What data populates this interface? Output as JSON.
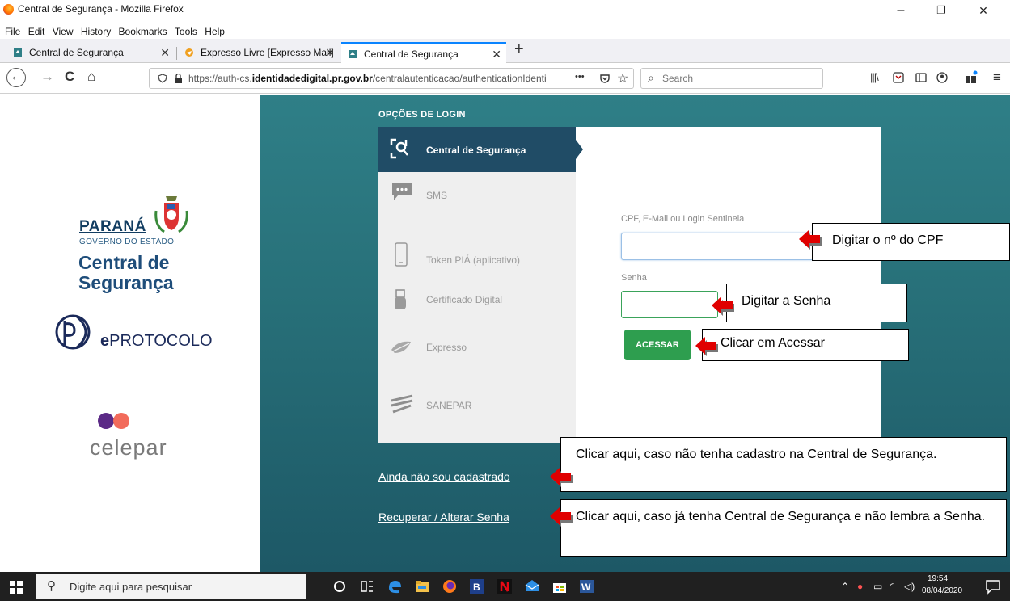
{
  "window": {
    "title": "Central de Segurança - Mozilla Firefox",
    "controls": {
      "minimize": "–",
      "maximize": "❐",
      "close": "✕"
    }
  },
  "menu": [
    "File",
    "Edit",
    "View",
    "History",
    "Bookmarks",
    "Tools",
    "Help"
  ],
  "tabs": [
    {
      "label": "Central de Segurança",
      "close": "✕"
    },
    {
      "label": "Expresso Livre [Expresso Mail]",
      "close": "✕"
    },
    {
      "label": "Central de Segurança",
      "close": "✕"
    }
  ],
  "new_tab": "+",
  "nav": {
    "back": "←",
    "forward": "→",
    "reload": "C",
    "home": "⌂",
    "url_prefix": "https://auth-cs.",
    "url_domain": "identidadedigital.pr.gov.br",
    "url_path": "/centralautenticacao/authenticationIdenti",
    "more": "•••",
    "search_placeholder": "Search"
  },
  "left": {
    "parana": "PARANÁ",
    "governo": "GOVERNO DO ESTADO",
    "central1": "Central de",
    "central2": "Segurança",
    "eprotocolo_e": "e",
    "eprotocolo_rest": "PROTOCOLO",
    "celepar": "celepar"
  },
  "login": {
    "heading": "OPÇÕES DE LOGIN",
    "options": [
      {
        "label": "Central de Segurança"
      },
      {
        "label": "SMS"
      },
      {
        "label": "Token PIÁ (aplicativo)"
      },
      {
        "label": "Certificado Digital"
      },
      {
        "label": "Expresso"
      },
      {
        "label": "SANEPAR"
      }
    ],
    "cpf_label": "CPF, E-Mail ou Login Sentinela",
    "cpf_value": "",
    "senha_label": "Senha",
    "senha_value": "",
    "button": "ACESSAR"
  },
  "links": {
    "cadastro": "Ainda não sou cadastrado",
    "recuperar": "Recuperar / Alterar Senha"
  },
  "callouts": {
    "cpf": "Digitar o nº do CPF",
    "senha": "Digitar a Senha",
    "acessar": "Clicar em Acessar",
    "cadastro": "Clicar aqui, caso não tenha cadastro na Central de Segurança.",
    "recuperar": "Clicar aqui, caso já tenha Central de Segurança e não lembra a Senha."
  },
  "taskbar": {
    "search_placeholder": "Digite aqui para pesquisar",
    "time": "19:54",
    "date": "08/04/2020"
  },
  "colors": {
    "teal": "#2f7f87",
    "menu_active": "#204c66",
    "button_green": "#2e9e4f",
    "arrow_red": "#e00000"
  }
}
